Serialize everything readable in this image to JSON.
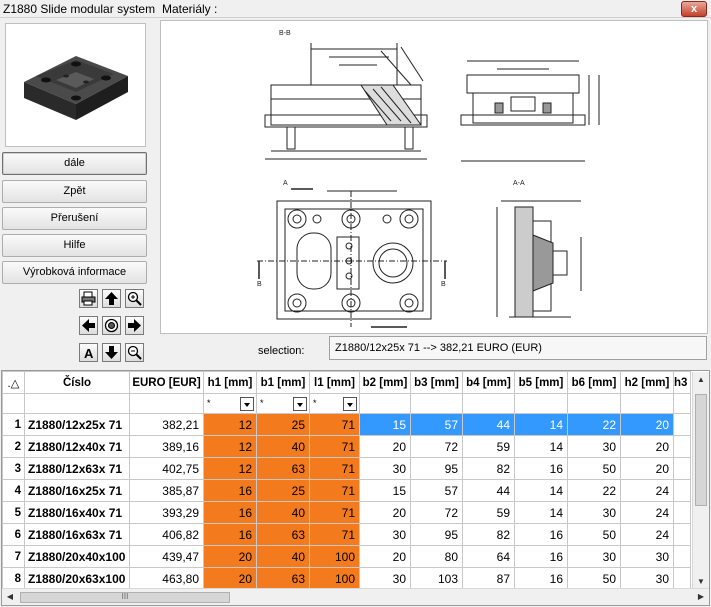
{
  "window": {
    "title": "Z1880 Slide modular system",
    "subtitle": "Materiály :",
    "close_label": "x"
  },
  "buttons": [
    {
      "label": "dále"
    },
    {
      "label": "Zpět"
    },
    {
      "label": "Přerušení"
    },
    {
      "label": "Hilfe"
    },
    {
      "label": "Výrobková informace"
    }
  ],
  "nav_icons": [
    "print-icon",
    "arrow-up-icon",
    "zoom-in-icon",
    "arrow-left-icon",
    "center-target-icon",
    "arrow-right-icon",
    "font-a-icon",
    "arrow-down-icon",
    "zoom-out-icon"
  ],
  "nav_labels": {
    "font": "A"
  },
  "selection": {
    "label": "selection:",
    "value": "Z1880/12x25x 71 --> 382,21 EURO (EUR)"
  },
  "drawing": {
    "section_bb": "B-B",
    "section_aa": "A-A",
    "marker_a": "A",
    "marker_b": "B"
  },
  "table": {
    "sort_header": ".△",
    "columns": [
      "Číslo",
      "EURO [EUR]",
      "h1 [mm]",
      "b1 [mm]",
      "l1 [mm]",
      "b2 [mm]",
      "b3 [mm]",
      "b4 [mm]",
      "b5 [mm]",
      "b6 [mm]",
      "h2 [mm]",
      "h3"
    ],
    "filters": [
      "*",
      "*",
      "*"
    ],
    "rows": [
      {
        "n": "1",
        "code": "Z1880/12x25x 71",
        "euro": "382,21",
        "h1": "12",
        "b1": "25",
        "l1": "71",
        "b2": "15",
        "b3": "57",
        "b4": "44",
        "b5": "14",
        "b6": "22",
        "h2": "20"
      },
      {
        "n": "2",
        "code": "Z1880/12x40x 71",
        "euro": "389,16",
        "h1": "12",
        "b1": "40",
        "l1": "71",
        "b2": "20",
        "b3": "72",
        "b4": "59",
        "b5": "14",
        "b6": "30",
        "h2": "20"
      },
      {
        "n": "3",
        "code": "Z1880/12x63x 71",
        "euro": "402,75",
        "h1": "12",
        "b1": "63",
        "l1": "71",
        "b2": "30",
        "b3": "95",
        "b4": "82",
        "b5": "16",
        "b6": "50",
        "h2": "20"
      },
      {
        "n": "4",
        "code": "Z1880/16x25x 71",
        "euro": "385,87",
        "h1": "16",
        "b1": "25",
        "l1": "71",
        "b2": "15",
        "b3": "57",
        "b4": "44",
        "b5": "14",
        "b6": "22",
        "h2": "24"
      },
      {
        "n": "5",
        "code": "Z1880/16x40x 71",
        "euro": "393,29",
        "h1": "16",
        "b1": "40",
        "l1": "71",
        "b2": "20",
        "b3": "72",
        "b4": "59",
        "b5": "14",
        "b6": "30",
        "h2": "24"
      },
      {
        "n": "6",
        "code": "Z1880/16x63x 71",
        "euro": "406,82",
        "h1": "16",
        "b1": "63",
        "l1": "71",
        "b2": "30",
        "b3": "95",
        "b4": "82",
        "b5": "16",
        "b6": "50",
        "h2": "24"
      },
      {
        "n": "7",
        "code": "Z1880/20x40x100",
        "euro": "439,47",
        "h1": "20",
        "b1": "40",
        "l1": "100",
        "b2": "20",
        "b3": "80",
        "b4": "64",
        "b5": "16",
        "b6": "30",
        "h2": "30"
      },
      {
        "n": "8",
        "code": "Z1880/20x63x100",
        "euro": "463,80",
        "h1": "20",
        "b1": "63",
        "l1": "100",
        "b2": "30",
        "b3": "103",
        "b4": "87",
        "b5": "16",
        "b6": "50",
        "h2": "30"
      }
    ],
    "hscroll_grip": "III"
  },
  "colors": {
    "highlight_orange": "#f47a1e",
    "selection_blue": "#3399ff"
  }
}
